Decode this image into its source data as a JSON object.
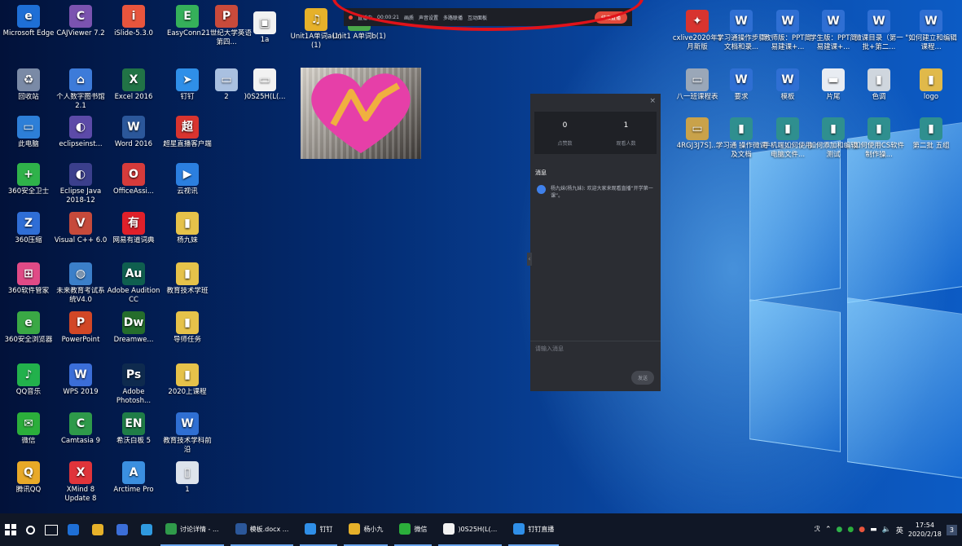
{
  "desktop_icons_col1": [
    {
      "label": "Microsoft Edge",
      "color": "#1e6fd6",
      "glyph": "e"
    },
    {
      "label": "回收站",
      "color": "#7a8aa6",
      "glyph": "♻"
    },
    {
      "label": "此电脑",
      "color": "#2d7fd8",
      "glyph": "▭"
    },
    {
      "label": "360安全卫士",
      "color": "#2fb24a",
      "glyph": "+"
    },
    {
      "label": "360压缩",
      "color": "#2f6ed6",
      "glyph": "Z"
    },
    {
      "label": "360软件管家",
      "color": "#e04a86",
      "glyph": "⊞"
    },
    {
      "label": "360安全浏览器",
      "color": "#3aa845",
      "glyph": "e"
    },
    {
      "label": "QQ音乐",
      "color": "#22b14c",
      "glyph": "♪"
    },
    {
      "label": "微信",
      "color": "#2bae3b",
      "glyph": "✉"
    },
    {
      "label": "腾讯QQ",
      "color": "#e8a928",
      "glyph": "Q"
    }
  ],
  "desktop_icons_col2": [
    {
      "label": "CAJViewer 7.2",
      "color": "#7b53b0",
      "glyph": "C"
    },
    {
      "label": "个人数字图书馆2.1",
      "color": "#3d7bd9",
      "glyph": "⌂"
    },
    {
      "label": "eclipseinst...",
      "color": "#5c4aa8",
      "glyph": "◐"
    },
    {
      "label": "Eclipse Java 2018-12",
      "color": "#3b3f8c",
      "glyph": "◐"
    },
    {
      "label": "Visual C++ 6.0",
      "color": "#c64a3b",
      "glyph": "V"
    },
    {
      "label": "未来教育考试系统V4.0",
      "color": "#3b7fc9",
      "glyph": "◍"
    },
    {
      "label": "PowerPoint",
      "color": "#d24726",
      "glyph": "P"
    },
    {
      "label": "WPS 2019",
      "color": "#3b6ed8",
      "glyph": "W"
    },
    {
      "label": "Camtasia 9",
      "color": "#2e9a4a",
      "glyph": "C"
    },
    {
      "label": "XMind 8 Update 8",
      "color": "#e0343a",
      "glyph": "X"
    }
  ],
  "desktop_icons_col3": [
    {
      "label": "iSlide-5.3.0",
      "color": "#e8553d",
      "glyph": "i"
    },
    {
      "label": "Excel 2016",
      "color": "#217346",
      "glyph": "X"
    },
    {
      "label": "Word 2016",
      "color": "#2b579a",
      "glyph": "W"
    },
    {
      "label": "OfficeAssi...",
      "color": "#d63b3b",
      "glyph": "O"
    },
    {
      "label": "网易有道词典",
      "color": "#e0202a",
      "glyph": "有"
    },
    {
      "label": "Adobe Audition CC",
      "color": "#0f5f4f",
      "glyph": "Au"
    },
    {
      "label": "Dreamwe...",
      "color": "#256d2c",
      "glyph": "Dw"
    },
    {
      "label": "Adobe Photosh...",
      "color": "#0e2a4e",
      "glyph": "Ps"
    },
    {
      "label": "希沃白板 5",
      "color": "#1f7d47",
      "glyph": "EN"
    },
    {
      "label": "Arctime Pro",
      "color": "#3b8fe0",
      "glyph": "A"
    }
  ],
  "desktop_icons_col4": [
    {
      "label": "EasyConn...",
      "color": "#35b05a",
      "glyph": "E"
    },
    {
      "label": "钉钉",
      "color": "#2f8fe8",
      "glyph": "➤"
    },
    {
      "label": "超星直播客户端",
      "color": "#d8342f",
      "glyph": "超"
    },
    {
      "label": "云视讯",
      "color": "#2b7fe0",
      "glyph": "▶"
    },
    {
      "label": "杨九妹",
      "color": "#e6c24a",
      "glyph": "▮"
    },
    {
      "label": "教育技术学班",
      "color": "#e6c24a",
      "glyph": "▮"
    },
    {
      "label": "导师任务",
      "color": "#e6c24a",
      "glyph": "▮"
    },
    {
      "label": "2020上课程",
      "color": "#e6c24a",
      "glyph": "▮"
    },
    {
      "label": "教育技术学科前沿",
      "color": "#2f6fd3",
      "glyph": "W"
    },
    {
      "label": "1",
      "color": "#dde3ec",
      "glyph": "▯"
    }
  ],
  "desktop_icons_col5": [
    {
      "label": "21世纪大学英语第四...",
      "color": "#c94a3b",
      "glyph": "P"
    },
    {
      "label": "2",
      "color": "#a9c0e0",
      "glyph": "▭"
    }
  ],
  "desktop_icons_col6": [
    {
      "label": "1a",
      "color": "#f2f2f2",
      "glyph": "▣"
    },
    {
      "label": ")0S25H(L(...",
      "color": "#f2f2f2",
      "glyph": "▭"
    }
  ],
  "desktop_icons_top_extra": [
    {
      "label": "Unit1A单词a(1)(1)",
      "color": "#e6b12a",
      "glyph": "♫"
    },
    {
      "label": "Unit1 A单词b(1)",
      "color": "#4aa84a",
      "glyph": "♫"
    }
  ],
  "desktop_icons_right_row1": [
    {
      "label": "cxlive2020年1月新版",
      "color": "#d8342f",
      "glyph": "✦"
    },
    {
      "label": "学习通操作步骤文档和录...",
      "color": "#2f6fd3",
      "glyph": "W"
    },
    {
      "label": "教师版：PPT简易建课+...",
      "color": "#2f6fd3",
      "glyph": "W"
    },
    {
      "label": "学生版：PPT简易建课+...",
      "color": "#2f6fd3",
      "glyph": "W"
    },
    {
      "label": "微课目录（第一批+第二...",
      "color": "#2f6fd3",
      "glyph": "W"
    },
    {
      "label": "\"如何建立和编辑课程...",
      "color": "#2f6fd3",
      "glyph": "W"
    }
  ],
  "desktop_icons_right_row2": [
    {
      "label": "八一班课程表",
      "color": "#9aa7b8",
      "glyph": "▭"
    },
    {
      "label": "要求",
      "color": "#2f6fd3",
      "glyph": "W"
    },
    {
      "label": "模板",
      "color": "#2f6fd3",
      "glyph": "W"
    },
    {
      "label": "片尾",
      "color": "#e8ecf2",
      "glyph": "▬"
    },
    {
      "label": "色调",
      "color": "#cfd6de",
      "glyph": "▮"
    },
    {
      "label": "logo",
      "color": "#e0b94a",
      "glyph": "▮"
    }
  ],
  "desktop_icons_right_row3": [
    {
      "label": "4RGJ3J7S]...",
      "color": "#c9a24a",
      "glyph": "▭"
    },
    {
      "label": "学习通 操作微课及文档",
      "color": "#2f8f8f",
      "glyph": "▮"
    },
    {
      "label": "手机端如何使用电脑文件...",
      "color": "#2f8f8f",
      "glyph": "▮"
    },
    {
      "label": "如何添加和编辑测试",
      "color": "#2f8f8f",
      "glyph": "▮"
    },
    {
      "label": "如何使用CS软件制作操...",
      "color": "#2f8f8f",
      "glyph": "▮"
    },
    {
      "label": "第二批 五组",
      "color": "#2f8f8f",
      "glyph": "▮"
    }
  ],
  "recbar": {
    "status": "直播中",
    "timer": "00:00:21",
    "items": [
      "画质",
      "声音设置",
      "多路联播",
      "互动面板"
    ],
    "stop_label": "结束直播"
  },
  "panel": {
    "close": "×",
    "stat1_value": "0",
    "stat1_label": "点赞数",
    "stat2_value": "1",
    "stat2_label": "观看人数",
    "messages_header": "消息",
    "message_text": "杨九妹(杨九妹): 欢迎大家来观看直播“开学第一课”。",
    "input_placeholder": "请输入消息",
    "send_label": "发送",
    "handle": "‹"
  },
  "taskbar": {
    "apps": [
      {
        "label": "讨论详情 - ...",
        "color": "#2f9a4a"
      },
      {
        "label": "模板.docx ...",
        "color": "#2b579a"
      },
      {
        "label": "钉钉",
        "color": "#2f8fe8"
      },
      {
        "label": "杨小九",
        "color": "#e6b12a"
      },
      {
        "label": "微信",
        "color": "#2bae3b"
      },
      {
        "label": ")0S25H(L(...",
        "color": "#f2f2f2"
      },
      {
        "label": "钉钉直播",
        "color": "#2f8fe8"
      }
    ],
    "ime": "英",
    "time": "17:54",
    "date": "2020/2/18",
    "notification": "3"
  }
}
